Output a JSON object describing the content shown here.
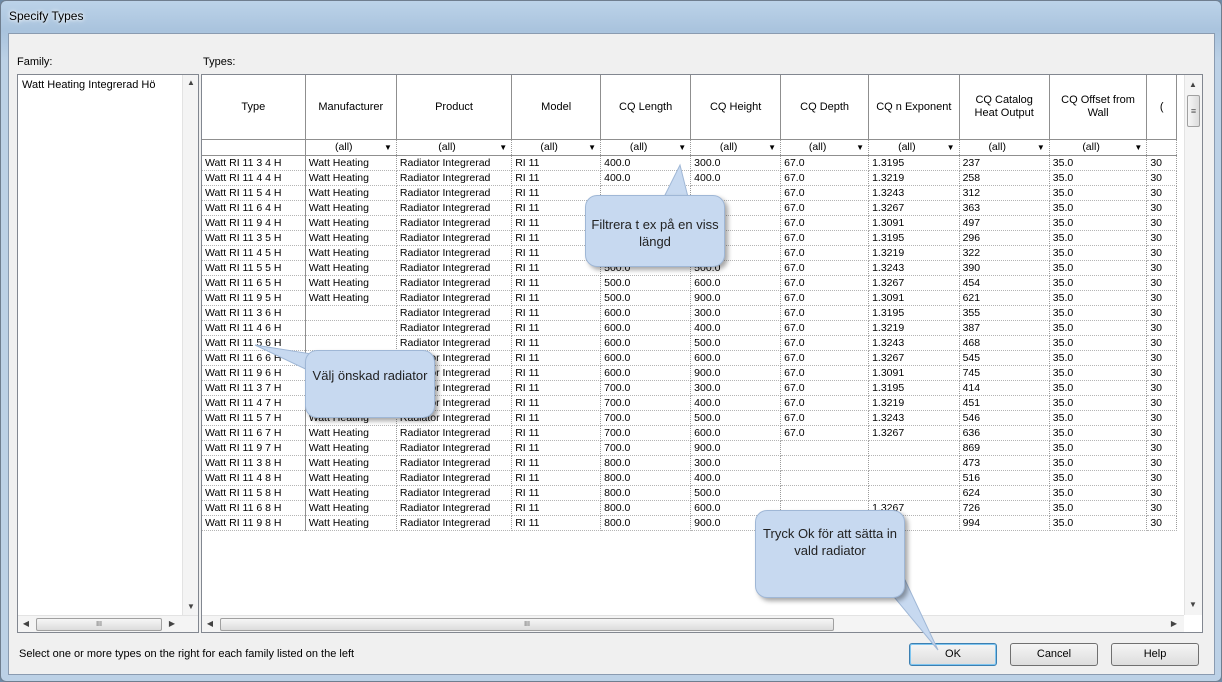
{
  "window": {
    "title": "Specify Types"
  },
  "labels": {
    "family": "Family:",
    "types": "Types:"
  },
  "family": {
    "items": [
      "Watt Heating Integrerad Hö"
    ]
  },
  "columns": [
    "Type",
    "Manufacturer",
    "Product",
    "Model",
    "CQ Length",
    "CQ Height",
    "CQ Depth",
    "CQ n Exponent",
    "CQ Catalog Heat Output",
    "CQ Offset from Wall",
    "("
  ],
  "filter_value": "(all)",
  "rows": [
    [
      "Watt RI 11 3 4 H",
      "Watt Heating",
      "Radiator Integrerad",
      "RI 11",
      "400.0",
      "300.0",
      "67.0",
      "1.3195",
      "237",
      "35.0",
      "30"
    ],
    [
      "Watt RI 11 4 4 H",
      "Watt Heating",
      "Radiator Integrerad",
      "RI 11",
      "400.0",
      "400.0",
      "67.0",
      "1.3219",
      "258",
      "35.0",
      "30"
    ],
    [
      "Watt RI 11 5 4 H",
      "Watt Heating",
      "Radiator Integrerad",
      "RI 11",
      "",
      "",
      "67.0",
      "1.3243",
      "312",
      "35.0",
      "30"
    ],
    [
      "Watt RI 11 6 4 H",
      "Watt Heating",
      "Radiator Integrerad",
      "RI 11",
      "",
      "",
      "67.0",
      "1.3267",
      "363",
      "35.0",
      "30"
    ],
    [
      "Watt RI 11 9 4 H",
      "Watt Heating",
      "Radiator Integrerad",
      "RI 11",
      "",
      "",
      "67.0",
      "1.3091",
      "497",
      "35.0",
      "30"
    ],
    [
      "Watt RI 11 3 5 H",
      "Watt Heating",
      "Radiator Integrerad",
      "RI 11",
      "",
      "",
      "67.0",
      "1.3195",
      "296",
      "35.0",
      "30"
    ],
    [
      "Watt RI 11 4 5 H",
      "Watt Heating",
      "Radiator Integrerad",
      "RI 11",
      "",
      "",
      "67.0",
      "1.3219",
      "322",
      "35.0",
      "30"
    ],
    [
      "Watt RI 11 5 5 H",
      "Watt Heating",
      "Radiator Integrerad",
      "RI 11",
      "500.0",
      "500.0",
      "67.0",
      "1.3243",
      "390",
      "35.0",
      "30"
    ],
    [
      "Watt RI 11 6 5 H",
      "Watt Heating",
      "Radiator Integrerad",
      "RI 11",
      "500.0",
      "600.0",
      "67.0",
      "1.3267",
      "454",
      "35.0",
      "30"
    ],
    [
      "Watt RI 11 9 5 H",
      "Watt Heating",
      "Radiator Integrerad",
      "RI 11",
      "500.0",
      "900.0",
      "67.0",
      "1.3091",
      "621",
      "35.0",
      "30"
    ],
    [
      "Watt RI 11 3 6 H",
      "",
      "Radiator Integrerad",
      "RI 11",
      "600.0",
      "300.0",
      "67.0",
      "1.3195",
      "355",
      "35.0",
      "30"
    ],
    [
      "Watt RI 11 4 6 H",
      "",
      "Radiator Integrerad",
      "RI 11",
      "600.0",
      "400.0",
      "67.0",
      "1.3219",
      "387",
      "35.0",
      "30"
    ],
    [
      "Watt RI 11 5 6 H",
      "",
      "Radiator Integrerad",
      "RI 11",
      "600.0",
      "500.0",
      "67.0",
      "1.3243",
      "468",
      "35.0",
      "30"
    ],
    [
      "Watt RI 11 6 6 H",
      "",
      "Radiator Integrerad",
      "RI 11",
      "600.0",
      "600.0",
      "67.0",
      "1.3267",
      "545",
      "35.0",
      "30"
    ],
    [
      "Watt RI 11 9 6 H",
      "Watt Heating",
      "Radiator Integrerad",
      "RI 11",
      "600.0",
      "900.0",
      "67.0",
      "1.3091",
      "745",
      "35.0",
      "30"
    ],
    [
      "Watt RI 11 3 7 H",
      "Watt Heating",
      "Radiator Integrerad",
      "RI 11",
      "700.0",
      "300.0",
      "67.0",
      "1.3195",
      "414",
      "35.0",
      "30"
    ],
    [
      "Watt RI 11 4 7 H",
      "Watt Heating",
      "Radiator Integrerad",
      "RI 11",
      "700.0",
      "400.0",
      "67.0",
      "1.3219",
      "451",
      "35.0",
      "30"
    ],
    [
      "Watt RI 11 5 7 H",
      "Watt Heating",
      "Radiator Integrerad",
      "RI 11",
      "700.0",
      "500.0",
      "67.0",
      "1.3243",
      "546",
      "35.0",
      "30"
    ],
    [
      "Watt RI 11 6 7 H",
      "Watt Heating",
      "Radiator Integrerad",
      "RI 11",
      "700.0",
      "600.0",
      "67.0",
      "1.3267",
      "636",
      "35.0",
      "30"
    ],
    [
      "Watt RI 11 9 7 H",
      "Watt Heating",
      "Radiator Integrerad",
      "RI 11",
      "700.0",
      "900.0",
      "",
      "",
      "869",
      "35.0",
      "30"
    ],
    [
      "Watt RI 11 3 8 H",
      "Watt Heating",
      "Radiator Integrerad",
      "RI 11",
      "800.0",
      "300.0",
      "",
      "",
      "473",
      "35.0",
      "30"
    ],
    [
      "Watt RI 11 4 8 H",
      "Watt Heating",
      "Radiator Integrerad",
      "RI 11",
      "800.0",
      "400.0",
      "",
      "",
      "516",
      "35.0",
      "30"
    ],
    [
      "Watt RI 11 5 8 H",
      "Watt Heating",
      "Radiator Integrerad",
      "RI 11",
      "800.0",
      "500.0",
      "",
      "",
      "624",
      "35.0",
      "30"
    ],
    [
      "Watt RI 11 6 8 H",
      "Watt Heating",
      "Radiator Integrerad",
      "RI 11",
      "800.0",
      "600.0",
      "",
      "1.3267",
      "726",
      "35.0",
      "30"
    ],
    [
      "Watt RI 11 9 8 H",
      "Watt Heating",
      "Radiator Integrerad",
      "RI 11",
      "800.0",
      "900.0",
      "67.0",
      "1.3091",
      "994",
      "35.0",
      "30"
    ]
  ],
  "status": {
    "hint": "Select one or more types on the right for each family listed on the left"
  },
  "buttons": {
    "ok": "OK",
    "cancel": "Cancel",
    "help": "Help"
  },
  "callouts": {
    "filter": "Filtrera t ex på en viss längd",
    "select": "Välj önskad radiator",
    "ok": "Tryck Ok för att sätta in vald radiator"
  },
  "scroll_glyphs": {
    "hscroll_grip": "III",
    "vscroll_grip": "≡"
  },
  "colors": {
    "callout_bg": "#c7d9f0",
    "titlebar": "#a9c3dd"
  }
}
